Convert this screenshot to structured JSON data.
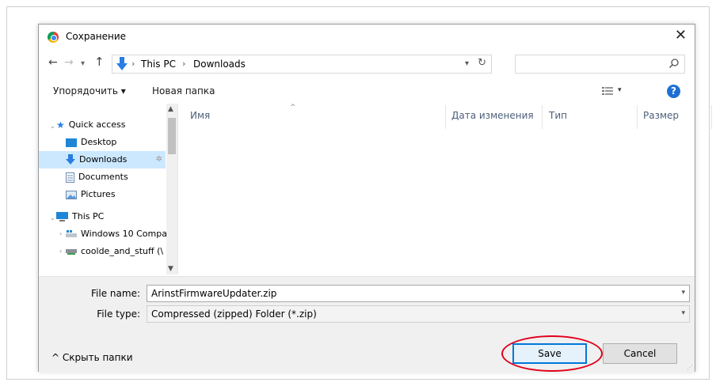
{
  "dialog": {
    "title": "Сохранение",
    "close_label": "✕"
  },
  "navigation": {
    "back": "←",
    "forward": "→",
    "recent": "▾",
    "up": "↑",
    "path": [
      "This PC",
      "Downloads"
    ],
    "separator": "›",
    "dropdown": "▾",
    "refresh": "↻",
    "search_placeholder": ""
  },
  "toolbar": {
    "organize": "Упорядочить ▾",
    "new_folder": "Новая папка",
    "view_dropdown": "▾",
    "help": "?"
  },
  "tree": {
    "quick_access": "Quick access",
    "items": [
      {
        "label": "Desktop",
        "icon": "desktop-icon"
      },
      {
        "label": "Downloads",
        "icon": "download-arrow-icon",
        "selected": true
      },
      {
        "label": "Documents",
        "icon": "document-icon"
      },
      {
        "label": "Pictures",
        "icon": "pictures-icon"
      }
    ],
    "this_pc": "This PC",
    "subitems": [
      {
        "label": "Windows 10 Compa",
        "icon": "drive-icon"
      },
      {
        "label": "coolde_and_stuff (\\",
        "icon": "network-drive-icon"
      }
    ],
    "pin_glyph": "✲",
    "expand_glyph": "›"
  },
  "file_list": {
    "sort_glyph": "^",
    "columns": [
      "Имя",
      "Дата изменения",
      "Тип",
      "Размер"
    ]
  },
  "save_form": {
    "file_name_label": "File name:",
    "file_name_value": "ArinstFirmwareUpdater.zip",
    "file_type_label": "File type:",
    "file_type_value": "Compressed (zipped) Folder (*.zip)",
    "combo_arrow": "▾",
    "hide_folders": "^  Скрыть папки",
    "save_label": "Save",
    "cancel_label": "Cancel"
  },
  "colors": {
    "accent": "#0078d7",
    "selection": "#cce8ff",
    "annotation": "#e1001a",
    "help": "#1e6fd4"
  }
}
